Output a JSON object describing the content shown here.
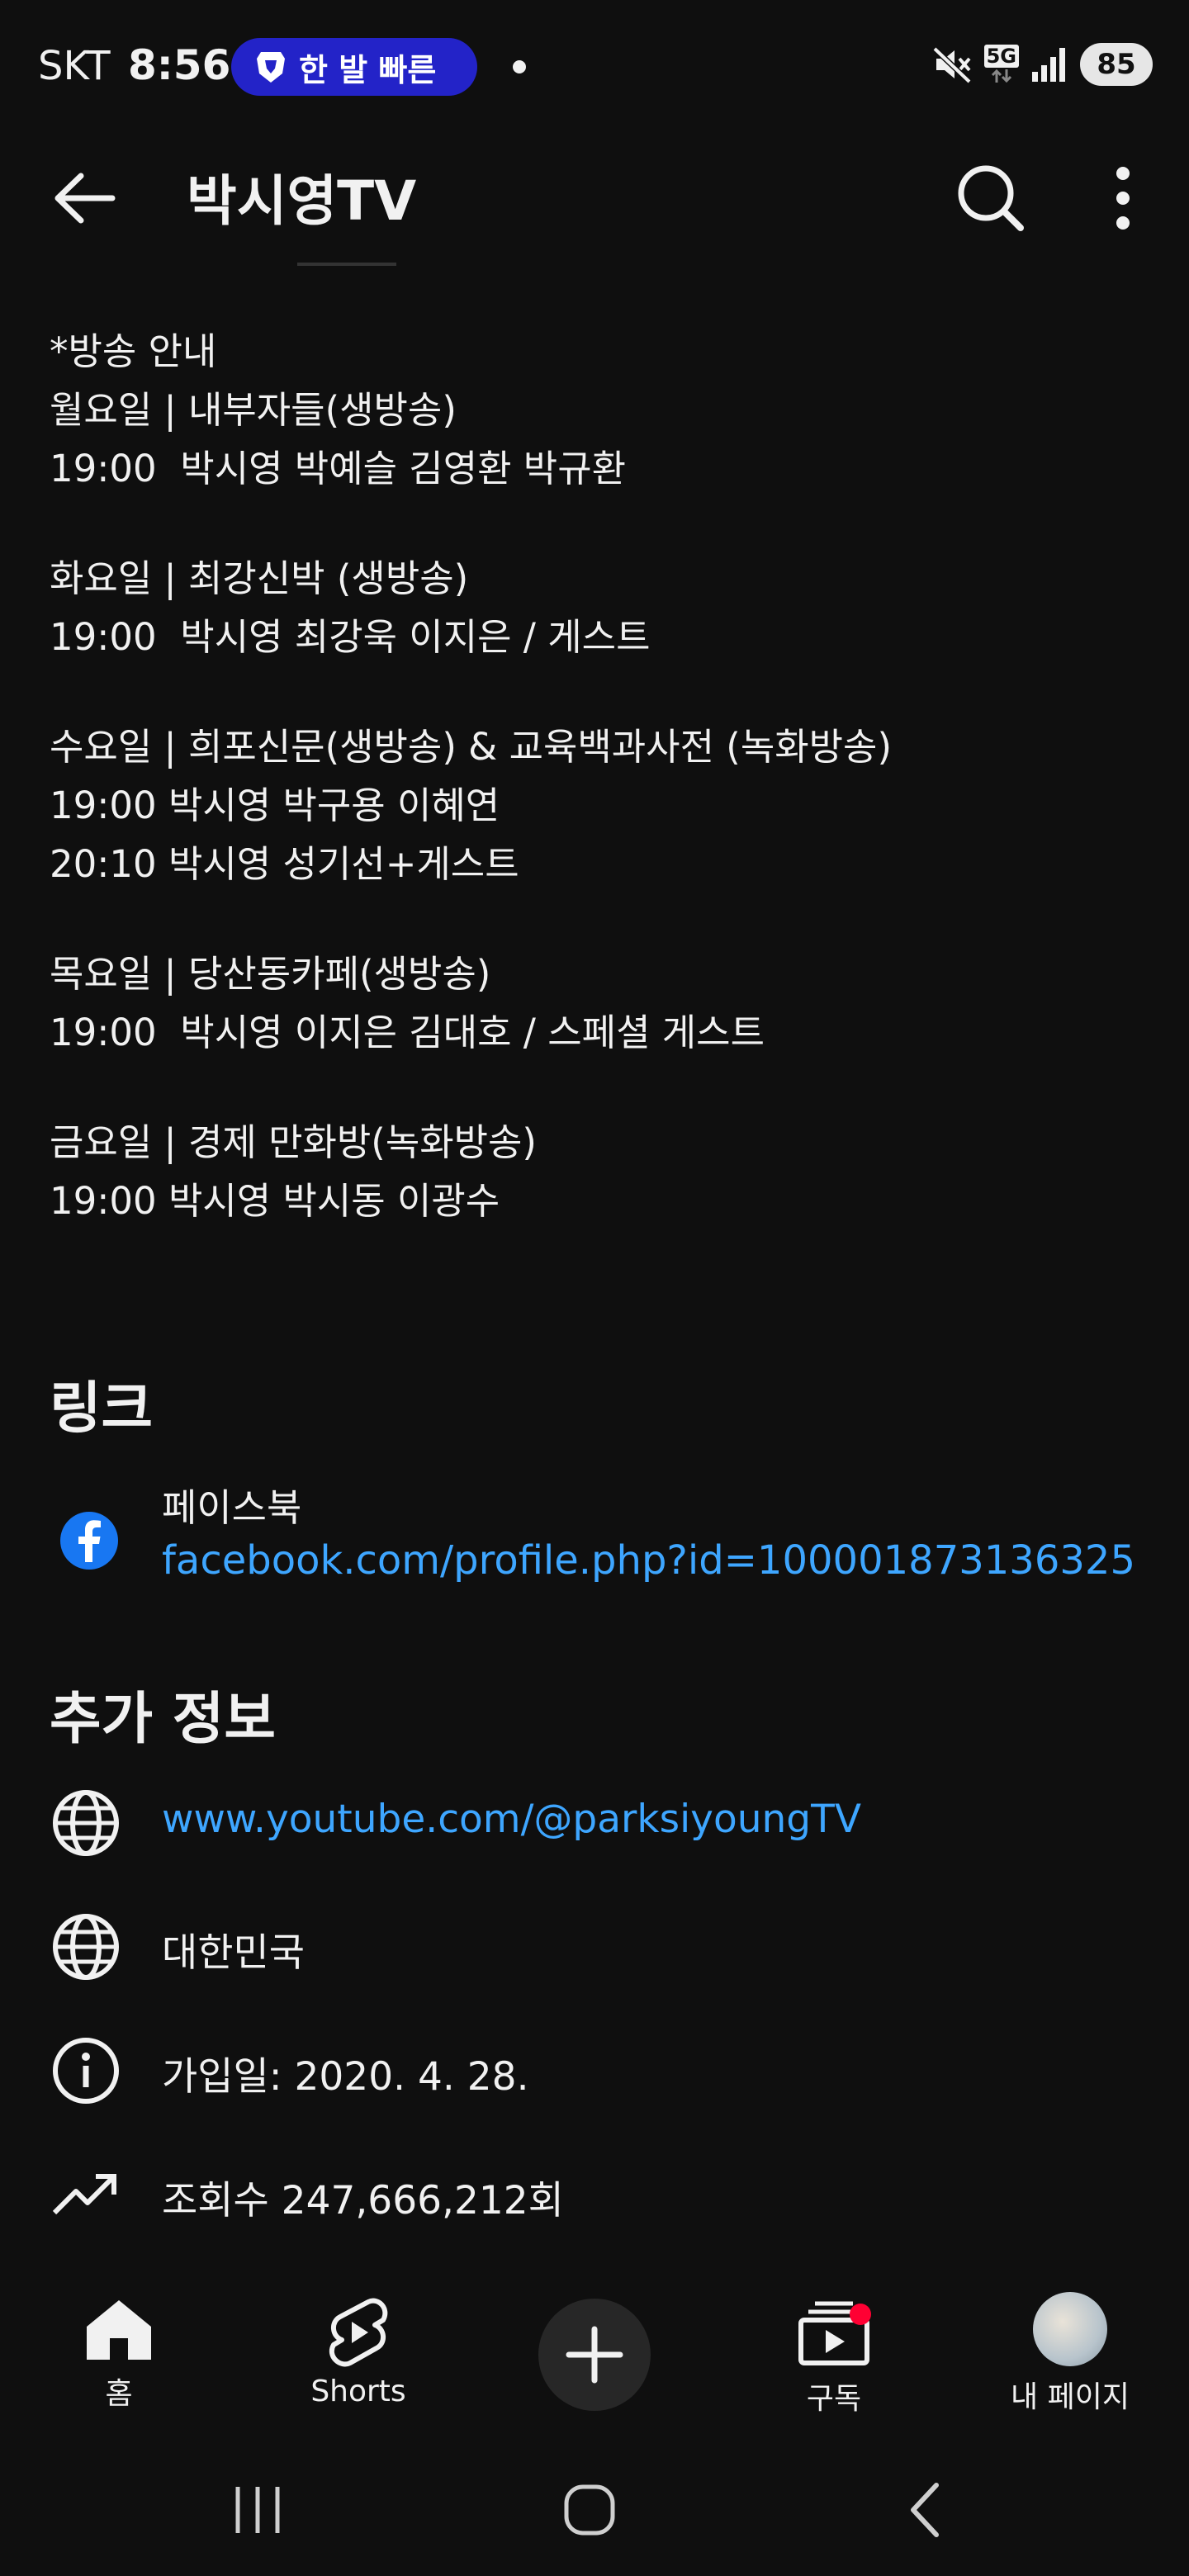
{
  "status_bar": {
    "carrier": "SKT",
    "time": "8:56",
    "pill_text": "한 발 빠른",
    "network": "5G",
    "battery": "85"
  },
  "header": {
    "title": "박시영TV"
  },
  "description": [
    [
      "*방송 안내",
      "월요일 | 내부자들(생방송)",
      "19:00  박시영 박예슬 김영환 박규환"
    ],
    [
      "화요일 | 최강신박 (생방송)",
      "19:00  박시영 최강욱 이지은 / 게스트"
    ],
    [
      "수요일 | 희포신문(생방송) & 교육백과사전 (녹화방송)",
      "19:00 박시영 박구용 이혜연",
      "20:10 박시영 성기선+게스트"
    ],
    [
      "목요일 | 당산동카페(생방송)",
      "19:00  박시영 이지은 김대호 / 스페셜 게스트"
    ],
    [
      "금요일 | 경제 만화방(녹화방송)",
      "19:00 박시영 박시동 이광수"
    ]
  ],
  "links_section": {
    "title": "링크",
    "items": [
      {
        "label": "페이스북",
        "url": "facebook.com/profile.php?id=100001873136325",
        "icon": "facebook-icon"
      }
    ]
  },
  "more_info": {
    "title": "추가 정보",
    "items": [
      {
        "icon": "globe-icon",
        "text": "www.youtube.com/@parksiyoungTV",
        "is_link": true
      },
      {
        "icon": "globe-icon",
        "text": "대한민국",
        "is_link": false
      },
      {
        "icon": "info-icon",
        "text": "가입일: 2020. 4. 28.",
        "is_link": false
      },
      {
        "icon": "trending-icon",
        "text": "조회수 247,666,212회",
        "is_link": false
      }
    ]
  },
  "bottom_nav": {
    "home": "홈",
    "shorts": "Shorts",
    "subscriptions": "구독",
    "you": "내 페이지"
  },
  "colors": {
    "background": "#0f0f0f",
    "text": "#f1f1f1",
    "link": "#3ea6ff",
    "badge": "#ff0033",
    "pill": "#2323c8"
  }
}
